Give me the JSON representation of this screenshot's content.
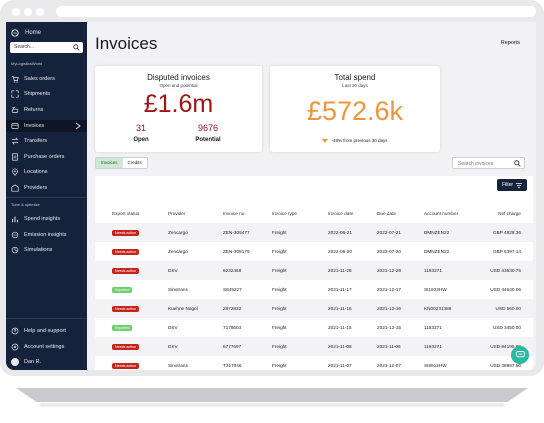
{
  "sidebar": {
    "home": "Home",
    "search_placeholder": "Search...",
    "org": "MyLogisticsWorld",
    "items": [
      {
        "label": "Sales orders",
        "icon": "cart-icon"
      },
      {
        "label": "Shipments",
        "icon": "shipment-icon"
      },
      {
        "label": "Returns",
        "icon": "return-icon"
      },
      {
        "label": "Invoices",
        "icon": "invoice-icon"
      },
      {
        "label": "Transfers",
        "icon": "transfer-icon"
      },
      {
        "label": "Purchase orders",
        "icon": "purchase-icon"
      },
      {
        "label": "Locations",
        "icon": "location-icon"
      },
      {
        "label": "Providers",
        "icon": "provider-icon"
      }
    ],
    "section2": "Tune & optimize",
    "tools": [
      {
        "label": "Spend insights",
        "icon": "spend-icon"
      },
      {
        "label": "Emission insights",
        "icon": "emission-icon"
      },
      {
        "label": "Simulations",
        "icon": "simulation-icon"
      }
    ],
    "footer": [
      {
        "label": "Help and support",
        "icon": "help-icon"
      },
      {
        "label": "Account settings",
        "icon": "settings-icon"
      },
      {
        "label": "Dan R.",
        "icon": "avatar"
      }
    ]
  },
  "header": {
    "title": "Invoices",
    "reports": "Reports"
  },
  "disputed": {
    "title": "Disputed invoices",
    "subtitle": "Open and potential",
    "amount": "£1.6m",
    "open_count": "31",
    "open_label": "Open",
    "potential_count": "9676",
    "potential_label": "Potential"
  },
  "spend": {
    "title": "Total spend",
    "subtitle": "Last 30 days",
    "amount": "£572.6k",
    "delta": "-48% from previous 30 days"
  },
  "tabs": [
    "Invoices",
    "Credits"
  ],
  "search_placeholder": "Search invoices",
  "filter_label": "Filter",
  "table": {
    "columns": [
      "Export status",
      "Provider",
      "Invoice no.",
      "Invoice type",
      "Invoice date",
      "Due date",
      "Account number",
      "Net charge"
    ],
    "rows": [
      {
        "status": "Needs action",
        "tone": "red",
        "provider": "Zencargo",
        "no": "ZEN-309477",
        "type": "Freight",
        "date": "2022-06-21",
        "due": "2022-07-21",
        "account": "DMNZEN22",
        "charge": "GBP 4828.36"
      },
      {
        "status": "Needs action",
        "tone": "red",
        "provider": "Zencargo",
        "no": "ZEN-308179",
        "type": "Freight",
        "date": "2022-06-20",
        "due": "2022-07-20",
        "account": "DMNZEN22",
        "charge": "GBP 5397.14"
      },
      {
        "status": "Needs action",
        "tone": "red",
        "provider": "DSV",
        "no": "6232468",
        "type": "Freight",
        "date": "2021-11-28",
        "due": "2021-12-28",
        "account": "1183271",
        "charge": "USD 43530.75"
      },
      {
        "status": "Exported",
        "tone": "green",
        "provider": "Sinotrans",
        "no": "S845227",
        "type": "Freight",
        "date": "2021-11-17",
        "due": "2021-12-17",
        "account": "SI1923HW",
        "charge": "USD 44640.06"
      },
      {
        "status": "Needs action",
        "tone": "red",
        "provider": "Kuehne Nagel",
        "no": "2872832",
        "type": "Freight",
        "date": "2021-11-16",
        "due": "2021-12-16",
        "account": "KN00231388",
        "charge": "USD 560.00"
      },
      {
        "status": "Exported",
        "tone": "green",
        "provider": "DSV",
        "no": "7178603",
        "type": "Freight",
        "date": "2021-11-15",
        "due": "2021-12-15",
        "account": "1183271",
        "charge": "USD 3450.00"
      },
      {
        "status": "Needs action",
        "tone": "red",
        "provider": "DSV",
        "no": "6777697",
        "type": "Freight",
        "date": "2021-11-08",
        "due": "2021-11-08",
        "account": "1183271",
        "charge": "USD 84195.89"
      },
      {
        "status": "Needs action",
        "tone": "red",
        "provider": "Sinotrans",
        "no": "T317046",
        "type": "Freight",
        "date": "2021-11-07",
        "due": "2021-12-07",
        "account": "SI8912HW",
        "charge": "USD 38987.50"
      }
    ]
  },
  "colors": {
    "brand": "#15223b",
    "red": "#a01414",
    "orange": "#f0943c",
    "chat": "#2bb9a6"
  }
}
